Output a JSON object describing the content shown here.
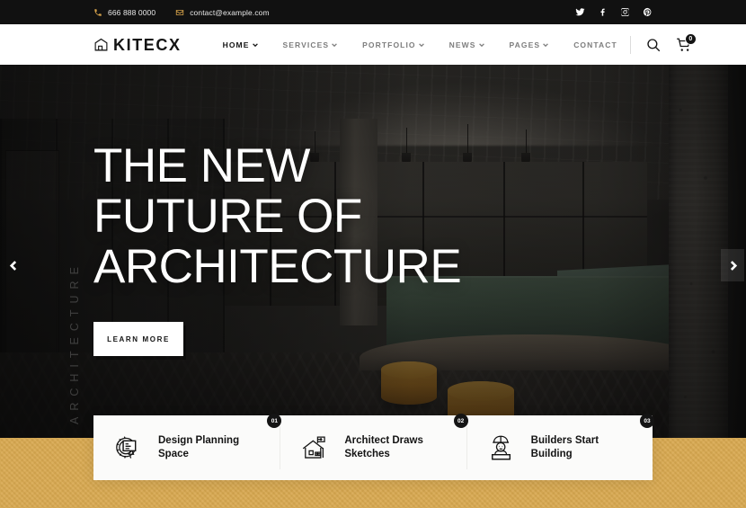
{
  "topbar": {
    "phone": {
      "icon": "phone-icon",
      "text": "666 888 0000"
    },
    "email": {
      "icon": "envelope-icon",
      "text": "contact@example.com"
    },
    "socials": [
      {
        "name": "twitter-icon",
        "label": "Twitter"
      },
      {
        "name": "facebook-icon",
        "label": "Facebook"
      },
      {
        "name": "instagram-icon",
        "label": "Instagram"
      },
      {
        "name": "pinterest-icon",
        "label": "Pinterest"
      }
    ],
    "background": "#111111",
    "icon_color": "#d6a24a"
  },
  "header": {
    "logo_text": "KITECX",
    "logo_icon": "building-house-icon",
    "nav": [
      {
        "label": "HOME",
        "has_dropdown": true,
        "active": true
      },
      {
        "label": "SERVICES",
        "has_dropdown": true,
        "active": false
      },
      {
        "label": "PORTFOLIO",
        "has_dropdown": true,
        "active": false
      },
      {
        "label": "NEWS",
        "has_dropdown": true,
        "active": false
      },
      {
        "label": "PAGES",
        "has_dropdown": true,
        "active": false
      },
      {
        "label": "CONTACT",
        "has_dropdown": false,
        "active": false
      }
    ],
    "search_icon": "search-icon",
    "cart_icon": "shopping-cart-icon",
    "cart_count": "0"
  },
  "hero": {
    "side_label": "ARCHITECTURE",
    "title_line1": "THE NEW",
    "title_line2": "FUTURE OF",
    "title_line3": "ARCHITECTURE",
    "cta_label": "LEARN MORE",
    "prev_label": "Previous slide",
    "next_label": "Next slide",
    "image_description": "Modern office interior with green banquette seating, mustard stools and concrete column"
  },
  "features": [
    {
      "number": "01",
      "icon": "gear-blueprint-icon",
      "line1": "Design Planning",
      "line2": "Space"
    },
    {
      "number": "02",
      "icon": "house-sketch-icon",
      "line1": "Architect Draws",
      "line2": "Sketches"
    },
    {
      "number": "03",
      "icon": "builder-worker-icon",
      "line1": "Builders Start",
      "line2": "Building"
    }
  ],
  "colors": {
    "accent_gold": "#d8a84f",
    "dark": "#141414",
    "white": "#ffffff"
  }
}
